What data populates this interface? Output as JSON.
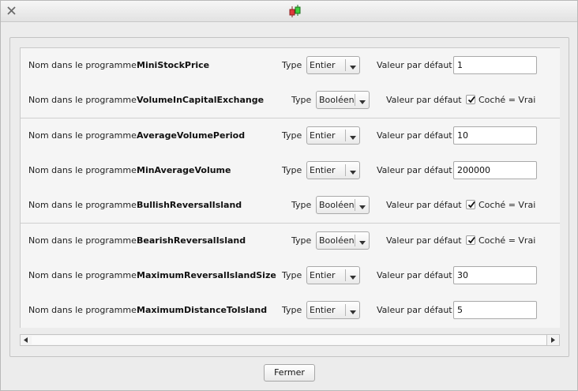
{
  "window": {
    "close_icon": "close-icon",
    "app_icon": "candlestick-icon"
  },
  "params": [
    {
      "prefix": "Nom dans le programme",
      "name": "MiniStockPrice",
      "type_label": "Type",
      "type": "Entier",
      "default_label": "Valeur par défaut",
      "value": "1",
      "kind": "input"
    },
    {
      "prefix": "Nom dans le programme",
      "name": "VolumeInCapitalExchange",
      "type_label": "Type",
      "type": "Booléen",
      "default_label": "Valeur par défaut",
      "checked": true,
      "check_label": "Coché = Vrai",
      "kind": "checkbox"
    },
    {
      "prefix": "Nom dans le programme",
      "name": "AverageVolumePeriod",
      "type_label": "Type",
      "type": "Entier",
      "default_label": "Valeur par défaut",
      "value": "10",
      "kind": "input"
    },
    {
      "prefix": "Nom dans le programme",
      "name": "MinAverageVolume",
      "type_label": "Type",
      "type": "Entier",
      "default_label": "Valeur par défaut",
      "value": "200000",
      "kind": "input"
    },
    {
      "prefix": "Nom dans le programme",
      "name": "BullishReversalIsland",
      "type_label": "Type",
      "type": "Booléen",
      "default_label": "Valeur par défaut",
      "checked": true,
      "check_label": "Coché = Vrai",
      "kind": "checkbox"
    },
    {
      "prefix": "Nom dans le programme",
      "name": "BearishReversalIsland",
      "type_label": "Type",
      "type": "Booléen",
      "default_label": "Valeur par défaut",
      "checked": true,
      "check_label": "Coché = Vrai",
      "kind": "checkbox"
    },
    {
      "prefix": "Nom dans le programme",
      "name": "MaximumReversalIslandSize",
      "type_label": "Type",
      "type": "Entier",
      "default_label": "Valeur par défaut",
      "value": "30",
      "kind": "input"
    },
    {
      "prefix": "Nom dans le programme",
      "name": "MaximumDistanceToIsland",
      "type_label": "Type",
      "type": "Entier",
      "default_label": "Valeur par défaut",
      "value": "5",
      "kind": "input"
    }
  ],
  "footer": {
    "close_label": "Fermer"
  }
}
